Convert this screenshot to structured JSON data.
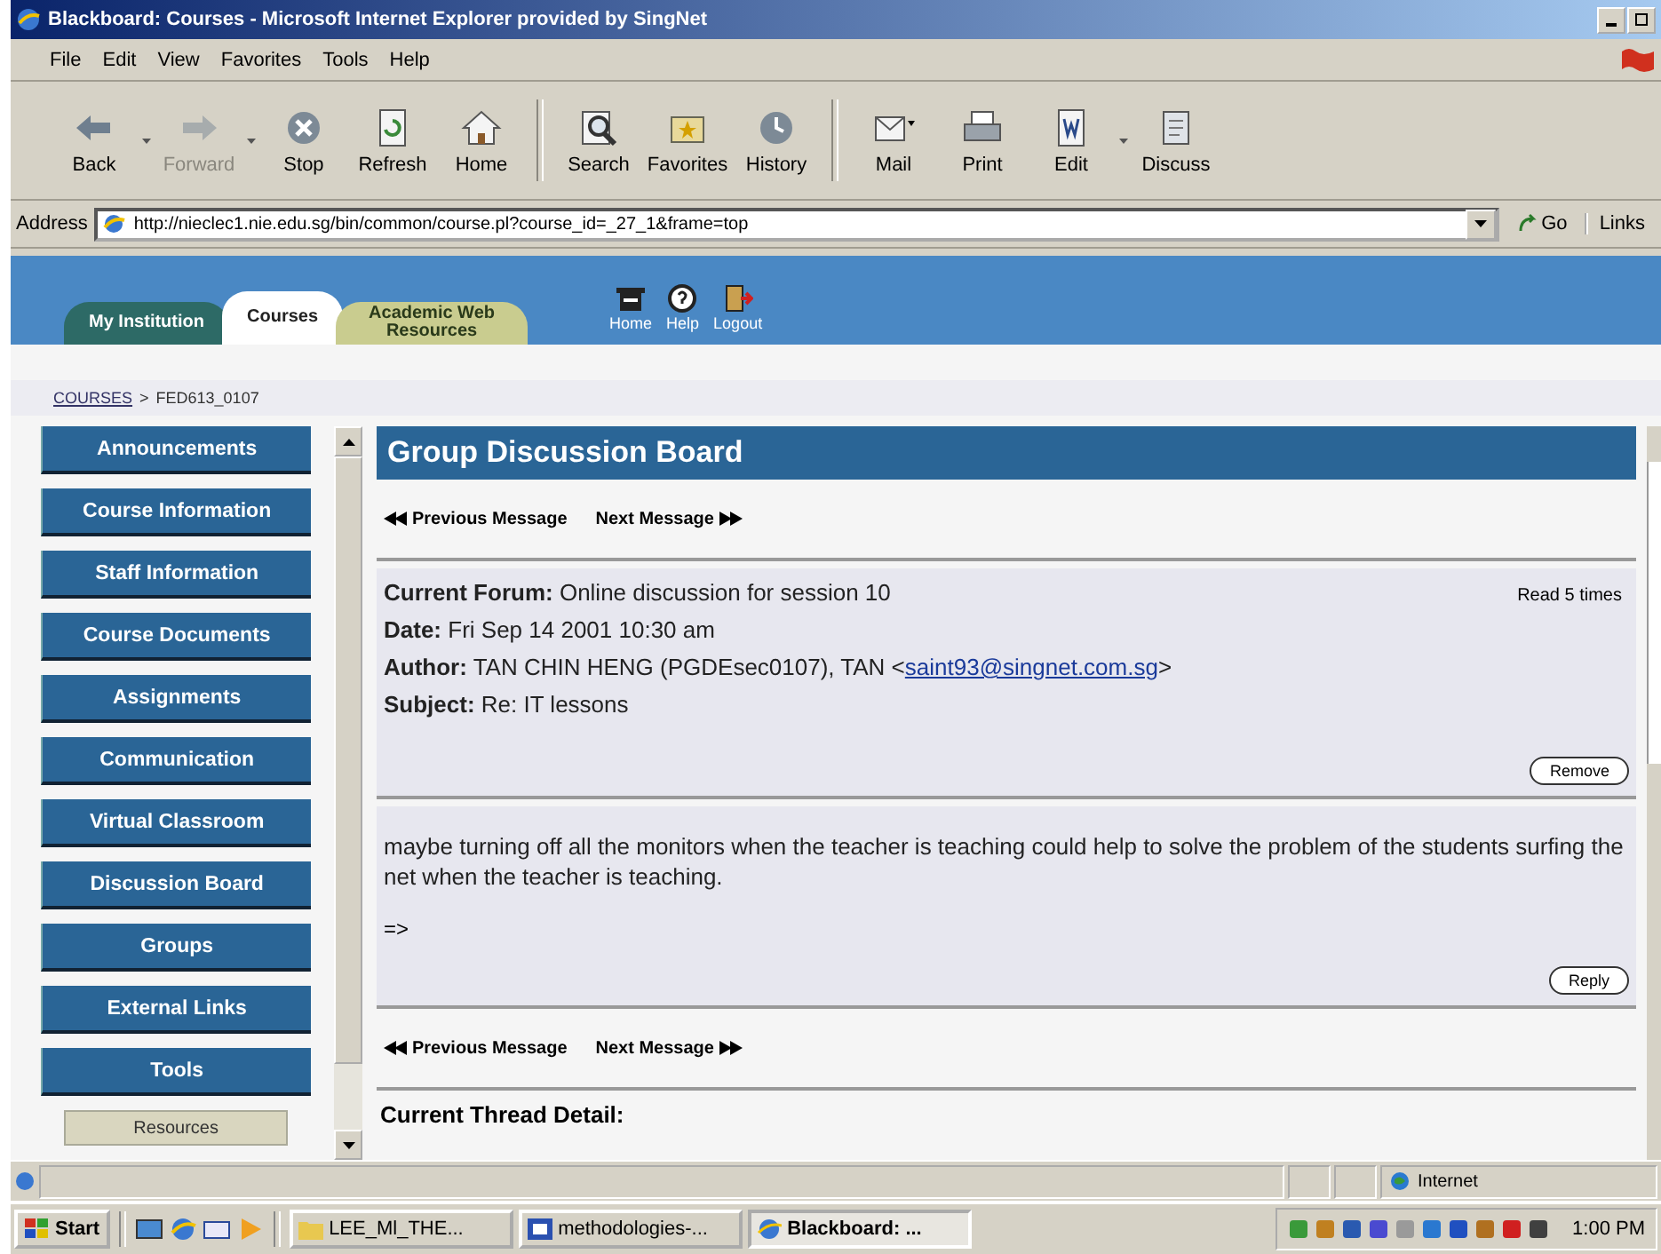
{
  "window": {
    "title": "Blackboard: Courses - Microsoft Internet Explorer provided by SingNet"
  },
  "menu": [
    "File",
    "Edit",
    "View",
    "Favorites",
    "Tools",
    "Help"
  ],
  "toolbar": [
    {
      "label": "Back",
      "kind": "back",
      "disabled": false,
      "dropdown": true
    },
    {
      "label": "Forward",
      "kind": "forward",
      "disabled": true,
      "dropdown": true
    },
    {
      "label": "Stop",
      "kind": "stop",
      "disabled": false,
      "dropdown": false
    },
    {
      "label": "Refresh",
      "kind": "refresh",
      "disabled": false,
      "dropdown": false
    },
    {
      "label": "Home",
      "kind": "home",
      "disabled": false,
      "dropdown": false
    },
    {
      "label": "Search",
      "kind": "search",
      "disabled": false,
      "dropdown": false
    },
    {
      "label": "Favorites",
      "kind": "favorites",
      "disabled": false,
      "dropdown": false
    },
    {
      "label": "History",
      "kind": "history",
      "disabled": false,
      "dropdown": false
    },
    {
      "label": "Mail",
      "kind": "mail",
      "disabled": false,
      "dropdown": false
    },
    {
      "label": "Print",
      "kind": "print",
      "disabled": false,
      "dropdown": false
    },
    {
      "label": "Edit",
      "kind": "edit",
      "disabled": false,
      "dropdown": true
    },
    {
      "label": "Discuss",
      "kind": "discuss",
      "disabled": false,
      "dropdown": false
    }
  ],
  "address": {
    "label": "Address",
    "url": "http://nieclec1.nie.edu.sg/bin/common/course.pl?course_id=_27_1&frame=top",
    "go": "Go",
    "links": "Links"
  },
  "tabs": [
    {
      "label": "My Institution",
      "selected": false,
      "color": "#2d6a66"
    },
    {
      "label": "Courses",
      "selected": true,
      "color": "#ffffff"
    },
    {
      "label": "Academic Web Resources",
      "selected": false,
      "color": "#c9cc8f"
    }
  ],
  "top_links": [
    {
      "label": "Home",
      "kind": "home"
    },
    {
      "label": "Help",
      "kind": "help"
    },
    {
      "label": "Logout",
      "kind": "logout"
    }
  ],
  "breadcrumb": {
    "link": "COURSES",
    "separator": ">",
    "current": "FED613_0107"
  },
  "nav": [
    {
      "label": "Announcements",
      "kind": "main"
    },
    {
      "label": "Course Information",
      "kind": "main"
    },
    {
      "label": "Staff Information",
      "kind": "main"
    },
    {
      "label": "Course Documents",
      "kind": "main"
    },
    {
      "label": "Assignments",
      "kind": "main"
    },
    {
      "label": "Communication",
      "kind": "main"
    },
    {
      "label": "Virtual Classroom",
      "kind": "main"
    },
    {
      "label": "Discussion Board",
      "kind": "main"
    },
    {
      "label": "Groups",
      "kind": "main"
    },
    {
      "label": "External Links",
      "kind": "main"
    },
    {
      "label": "Tools",
      "kind": "main"
    },
    {
      "label": "Resources",
      "kind": "secondary"
    }
  ],
  "content": {
    "title": "Group Discussion Board",
    "pager_top": {
      "previous": "Previous Message",
      "next": "Next Message"
    },
    "read_count": "Read 5 times",
    "fields": [
      {
        "label": "Current Forum:",
        "value": "Online discussion for session 10"
      },
      {
        "label": "Date:",
        "value": "Fri Sep 14 2001 10:30 am"
      },
      {
        "label": "Author:",
        "value": "TAN CHIN HENG (PGDEsec0107), TAN <",
        "email": "saint93@singnet.com.sg",
        "suffix": ">"
      },
      {
        "label": "Subject:",
        "value": "Re: IT lessons"
      }
    ],
    "remove": "Remove",
    "body": "maybe turning off all the monitors when the teacher is teaching could help to solve the problem of the students surfing the net when the teacher is teaching.",
    "quote": "=>",
    "reply": "Reply",
    "pager_bottom": {
      "previous": "Previous Message",
      "next": "Next Message"
    },
    "thread_heading": "Current Thread Detail:"
  },
  "status_bar": {
    "zone": "Internet"
  },
  "taskbar": {
    "start": "Start",
    "tasks": [
      {
        "label": "LEE_Ml_THE...",
        "kind": "folder",
        "selected": false
      },
      {
        "label": "methodologies-...",
        "kind": "word",
        "selected": false
      },
      {
        "label": "Blackboard: ...",
        "kind": "browser",
        "selected": true
      }
    ],
    "clock": "1:00 PM"
  }
}
